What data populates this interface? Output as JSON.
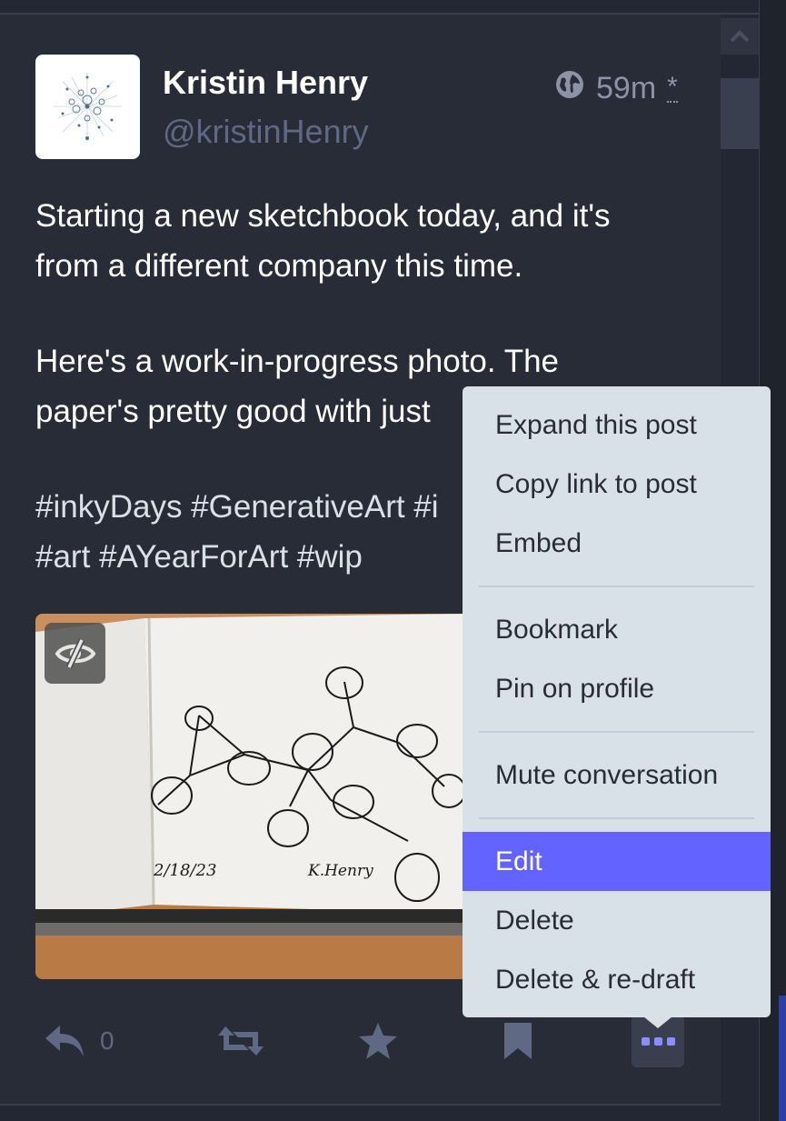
{
  "post": {
    "display_name": "Kristin Henry",
    "handle": "@kristinHenry",
    "visibility_icon": "globe-icon",
    "timestamp": "59m",
    "edited_marker": "*",
    "paragraphs": [
      [
        "Starting a new sketchbook today, and it's",
        "from a different company this time."
      ],
      [
        "Here's a work-in-progress photo. The",
        "paper's pretty good with just"
      ],
      [
        "#inkyDays #GenerativeArt #i",
        "#art #AYearForArt #wip"
      ]
    ],
    "media": {
      "date_text": "2/18/23",
      "signature_text": "K.Henry",
      "hide_icon": "eye-slash-icon"
    },
    "actions": {
      "reply_icon": "reply-icon",
      "reply_count": "0",
      "boost_icon": "boost-icon",
      "favourite_icon": "star-icon",
      "bookmark_icon": "bookmark-icon",
      "more_icon": "ellipsis-icon"
    }
  },
  "menu": {
    "groups": [
      [
        "Expand this post",
        "Copy link to post",
        "Embed"
      ],
      [
        "Bookmark",
        "Pin on profile"
      ],
      [
        "Mute conversation"
      ],
      [
        "Edit",
        "Delete",
        "Delete & re-draft"
      ]
    ],
    "active_item": "Edit"
  },
  "colors": {
    "background": "#282c37",
    "menu_bg": "#d9e1e8",
    "accent": "#6364ff",
    "muted": "#606984"
  }
}
